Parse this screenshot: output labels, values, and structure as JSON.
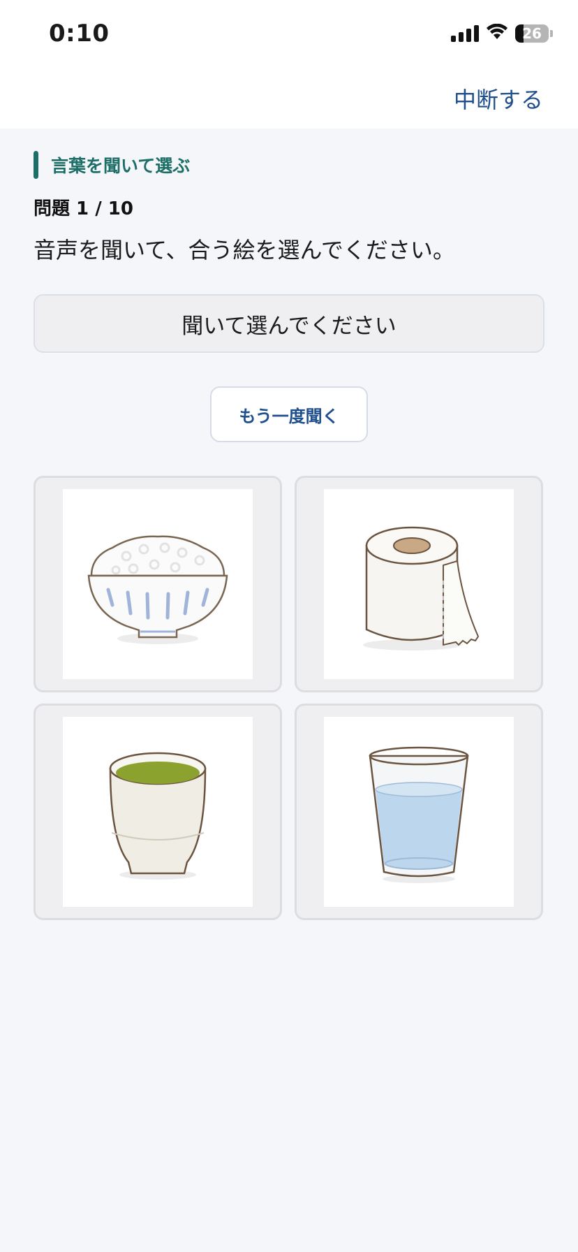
{
  "status_bar": {
    "time": "0:10",
    "battery": "26"
  },
  "nav": {
    "quit_label": "中断する"
  },
  "quiz": {
    "section_label": "言葉を聞いて選ぶ",
    "counter": "問題 1 / 10",
    "instruction": "音声を聞いて、合う絵を選んでください。",
    "answer_placeholder": "聞いて選んでください",
    "replay_label": "もう一度聞く",
    "choices": [
      {
        "icon": "rice-bowl-icon"
      },
      {
        "icon": "toilet-paper-icon"
      },
      {
        "icon": "green-tea-cup-icon"
      },
      {
        "icon": "water-glass-icon"
      }
    ]
  },
  "colors": {
    "accent_teal": "#1e6e68",
    "link_blue": "#1f4e8c",
    "background": "#f4f6fa"
  }
}
